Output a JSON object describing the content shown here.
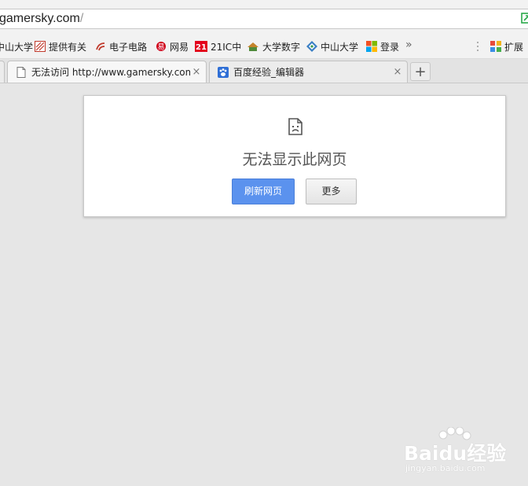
{
  "address_bar": {
    "url_main": "gamersky.com",
    "url_tail": "/"
  },
  "bookmarks": [
    {
      "label": "中山大学",
      "icon": "university-icon"
    },
    {
      "label": "提供有关",
      "icon": "striped-page-icon"
    },
    {
      "label": "电子电路",
      "icon": "circuit-site-icon"
    },
    {
      "label": "网易",
      "icon": "netease-icon"
    },
    {
      "label": "21IC中",
      "icon": "21ic-icon"
    },
    {
      "label": "大学数字",
      "icon": "house-icon"
    },
    {
      "label": "中山大学",
      "icon": "diamond-grid-icon"
    },
    {
      "label": "登录",
      "icon": "windows-logo-icon"
    }
  ],
  "bookmarks_more": "»",
  "extensions_label": "扩展",
  "tabs": [
    {
      "title": "无法访问 http://www.gamersky.com",
      "active": true,
      "icon": "page-icon"
    },
    {
      "title": "百度经验_编辑器",
      "active": false,
      "icon": "baidu-paw-icon"
    }
  ],
  "tab_close_glyph": "×",
  "new_tab_glyph": "+",
  "error": {
    "message": "无法显示此网页",
    "reload_button": "刷新网页",
    "more_button": "更多"
  },
  "watermark": {
    "logo_text": "Baidu经验",
    "url": "jingyan.baidu.com"
  },
  "colors": {
    "primary_button": "#5b92ee",
    "background": "#e6e6e6"
  }
}
